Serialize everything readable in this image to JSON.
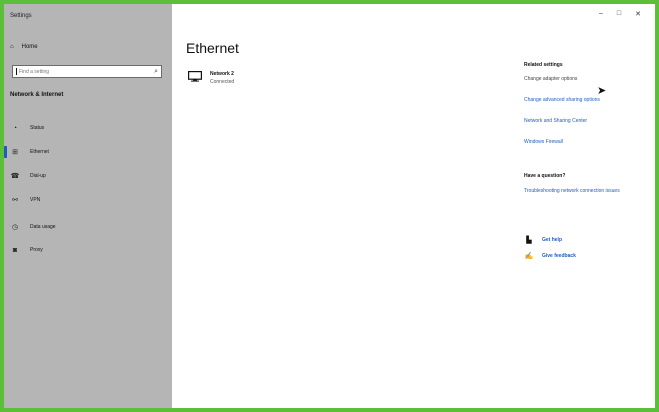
{
  "window": {
    "title": "Settings",
    "controls": {
      "minimize": "–",
      "maximize": "□",
      "close": "✕"
    }
  },
  "sidebar": {
    "home_label": "Home",
    "search": {
      "value": "",
      "placeholder": "Find a setting"
    },
    "section_title": "Network & Internet",
    "items": [
      {
        "label": "Status",
        "icon": "status-icon"
      },
      {
        "label": "Ethernet",
        "icon": "ethernet-icon",
        "active": true
      },
      {
        "label": "Dial-up",
        "icon": "dialup-icon"
      },
      {
        "label": "VPN",
        "icon": "vpn-icon"
      },
      {
        "label": "Data usage",
        "icon": "data-usage-icon"
      },
      {
        "label": "Proxy",
        "icon": "proxy-icon"
      }
    ]
  },
  "main": {
    "title": "Ethernet",
    "network": {
      "name": "Network 2",
      "status": "Connected"
    },
    "related_settings": {
      "title": "Related settings",
      "change_adapter": "Change adapter options",
      "links": [
        "Change advanced sharing options",
        "Network and Sharing Center",
        "Windows Firewall"
      ]
    },
    "question": {
      "title": "Have a question?",
      "link": "Troubleshooting network connection issues"
    },
    "help": {
      "get_help": "Get help",
      "give_feedback": "Give feedback"
    }
  },
  "colors": {
    "accent": "#1f5dbf",
    "sidebar": "#b5b5b5",
    "frame": "#5bbf3a"
  }
}
